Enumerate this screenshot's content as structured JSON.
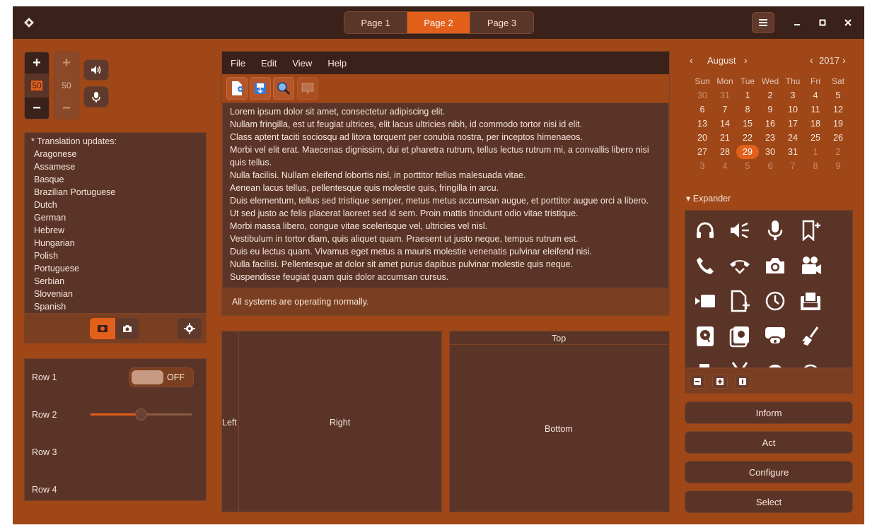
{
  "titlebar": {
    "tabs": [
      "Page 1",
      "Page 2",
      "Page 3"
    ],
    "active_tab": "Page 2",
    "icons": [
      "app-icon",
      "menu-icon",
      "minimize-icon",
      "maximize-icon",
      "close-icon"
    ]
  },
  "spin1": {
    "value": "50"
  },
  "spin2": {
    "value": "50"
  },
  "translations": {
    "header": "* Translation updates:",
    "items": [
      "Aragonese",
      "Assamese",
      "Basque",
      "Brazilian Portuguese",
      "Dutch",
      "German",
      "Hebrew",
      "Hungarian",
      "Polish",
      "Portuguese",
      "Serbian",
      "Slovenian",
      "Spanish"
    ]
  },
  "rows": {
    "labels": [
      "Row 1",
      "Row 2",
      "Row 3",
      "Row 4"
    ],
    "switch_text": "OFF",
    "slider_fraction": 0.5
  },
  "editor": {
    "menu": [
      "File",
      "Edit",
      "View",
      "Help"
    ],
    "lines": [
      "Lorem ipsum dolor sit amet, consectetur adipiscing elit.",
      "Nullam fringilla, est ut feugiat ultrices, elit lacus ultricies nibh, id commodo tortor nisi id elit.",
      "Class aptent taciti sociosqu ad litora torquent per conubia nostra, per inceptos himenaeos.",
      "Morbi vel elit erat. Maecenas dignissim, dui et pharetra rutrum, tellus lectus rutrum mi, a convallis libero nisi",
      "quis tellus.",
      "Nulla facilisi. Nullam eleifend lobortis nisl, in porttitor tellus malesuada vitae.",
      "Aenean lacus tellus, pellentesque quis molestie quis, fringilla in arcu.",
      "Duis elementum, tellus sed tristique semper, metus metus accumsan augue, et porttitor augue orci a libero.",
      "Ut sed justo ac felis placerat laoreet sed id sem. Proin mattis tincidunt odio vitae tristique.",
      "Morbi massa libero, congue vitae scelerisque vel, ultricies vel nisl.",
      "Vestibulum in tortor diam, quis aliquet quam. Praesent ut justo neque, tempus rutrum est.",
      "Duis eu lectus quam. Vivamus eget metus a mauris molestie venenatis pulvinar eleifend nisi.",
      "Nulla facilisi. Pellentesque at dolor sit amet purus dapibus pulvinar molestie quis neque.",
      "Suspendisse feugiat quam quis dolor accumsan cursus."
    ],
    "status": "All systems are operating normally."
  },
  "panes": {
    "left": "Left",
    "right": "Right",
    "top": "Top",
    "bottom": "Bottom"
  },
  "calendar": {
    "month": "August",
    "year": "2017",
    "day_names": [
      "Sun",
      "Mon",
      "Tue",
      "Wed",
      "Thu",
      "Fri",
      "Sat"
    ],
    "weeks": [
      [
        "30",
        "31",
        "1",
        "2",
        "3",
        "4",
        "5"
      ],
      [
        "6",
        "7",
        "8",
        "9",
        "10",
        "11",
        "12"
      ],
      [
        "13",
        "14",
        "15",
        "16",
        "17",
        "18",
        "19"
      ],
      [
        "20",
        "21",
        "22",
        "23",
        "24",
        "25",
        "26"
      ],
      [
        "27",
        "28",
        "29",
        "30",
        "31",
        "1",
        "2"
      ],
      [
        "3",
        "4",
        "5",
        "6",
        "7",
        "8",
        "9"
      ]
    ],
    "selected": "29"
  },
  "expander": {
    "label": "Expander",
    "icons": [
      "headphones-icon",
      "speaker-icon",
      "microphone-icon",
      "bookmark-add-icon",
      "phone-icon",
      "hangup-icon",
      "camera-icon",
      "movie-camera-icon",
      "video-icon",
      "file-add-icon",
      "clock-icon",
      "clipboard-icon",
      "drive-icon",
      "media-icon",
      "printer-icon",
      "broom-icon"
    ]
  },
  "buttons": [
    "Inform",
    "Act",
    "Configure",
    "Select"
  ],
  "colors": {
    "accent": "#e3601b",
    "background": "#9f4717",
    "panel": "#5b3428",
    "titlebar": "#3a2119"
  }
}
